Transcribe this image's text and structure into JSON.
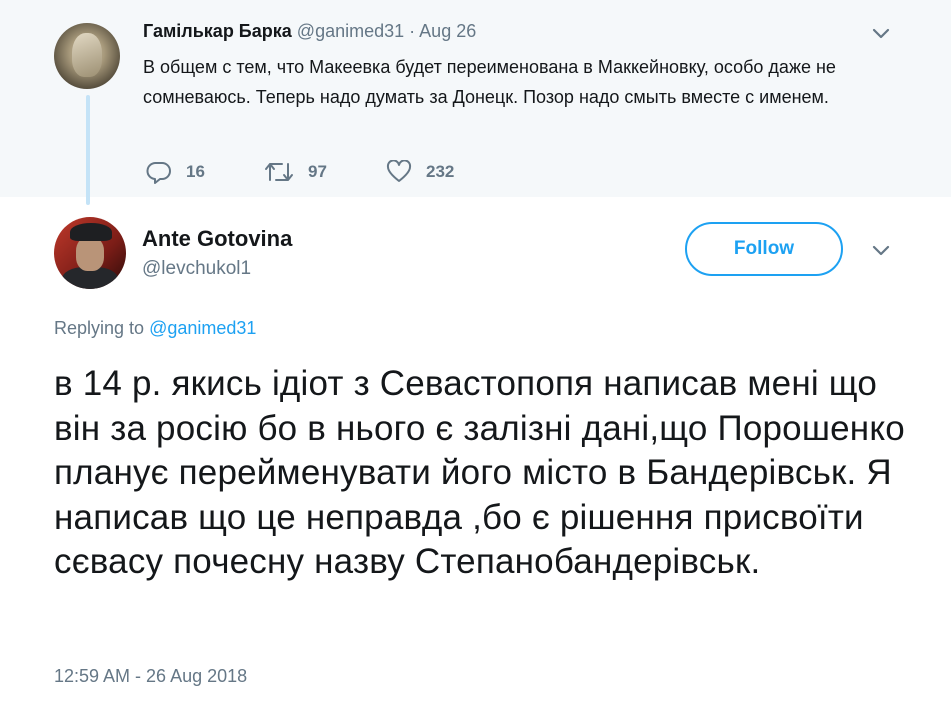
{
  "parent_tweet": {
    "author_name": "Гамількар Барка",
    "handle": "@ganimed31",
    "separator": "·",
    "date": "Aug 26",
    "text": "В общем с тем, что Макеевка будет переименована в Маккейновку, особо даже не сомневаюсь. Теперь надо думать за Донецк. Позор надо смыть вместе с именем.",
    "reply_count": "16",
    "retweet_count": "97",
    "like_count": "232"
  },
  "main_tweet": {
    "author_name": "Ante Gotovina",
    "handle": "@levchukol1",
    "follow_label": "Follow",
    "replying_prefix": "Replying to",
    "replying_to": "@ganimed31",
    "text": "в 14 р. якись ідіот з Севастопопя написав мені що він за росію бо в нього є залізні дані,що Порошенко планує перейменувати його місто в Бандерівськ. Я написав що це неправда ,бо є рішення присвоїти сєвасу почесну назву Степанобандерівськ.",
    "timestamp": "12:59 AM - 26 Aug 2018"
  },
  "colors": {
    "accent": "#1da1f2",
    "secondary_text": "#657786",
    "parent_background": "#f5f8fa",
    "thread_line": "#c4e3f7"
  },
  "icons": {
    "reply": "reply-icon",
    "retweet": "retweet-icon",
    "like": "heart-icon",
    "more": "chevron-down-icon"
  }
}
